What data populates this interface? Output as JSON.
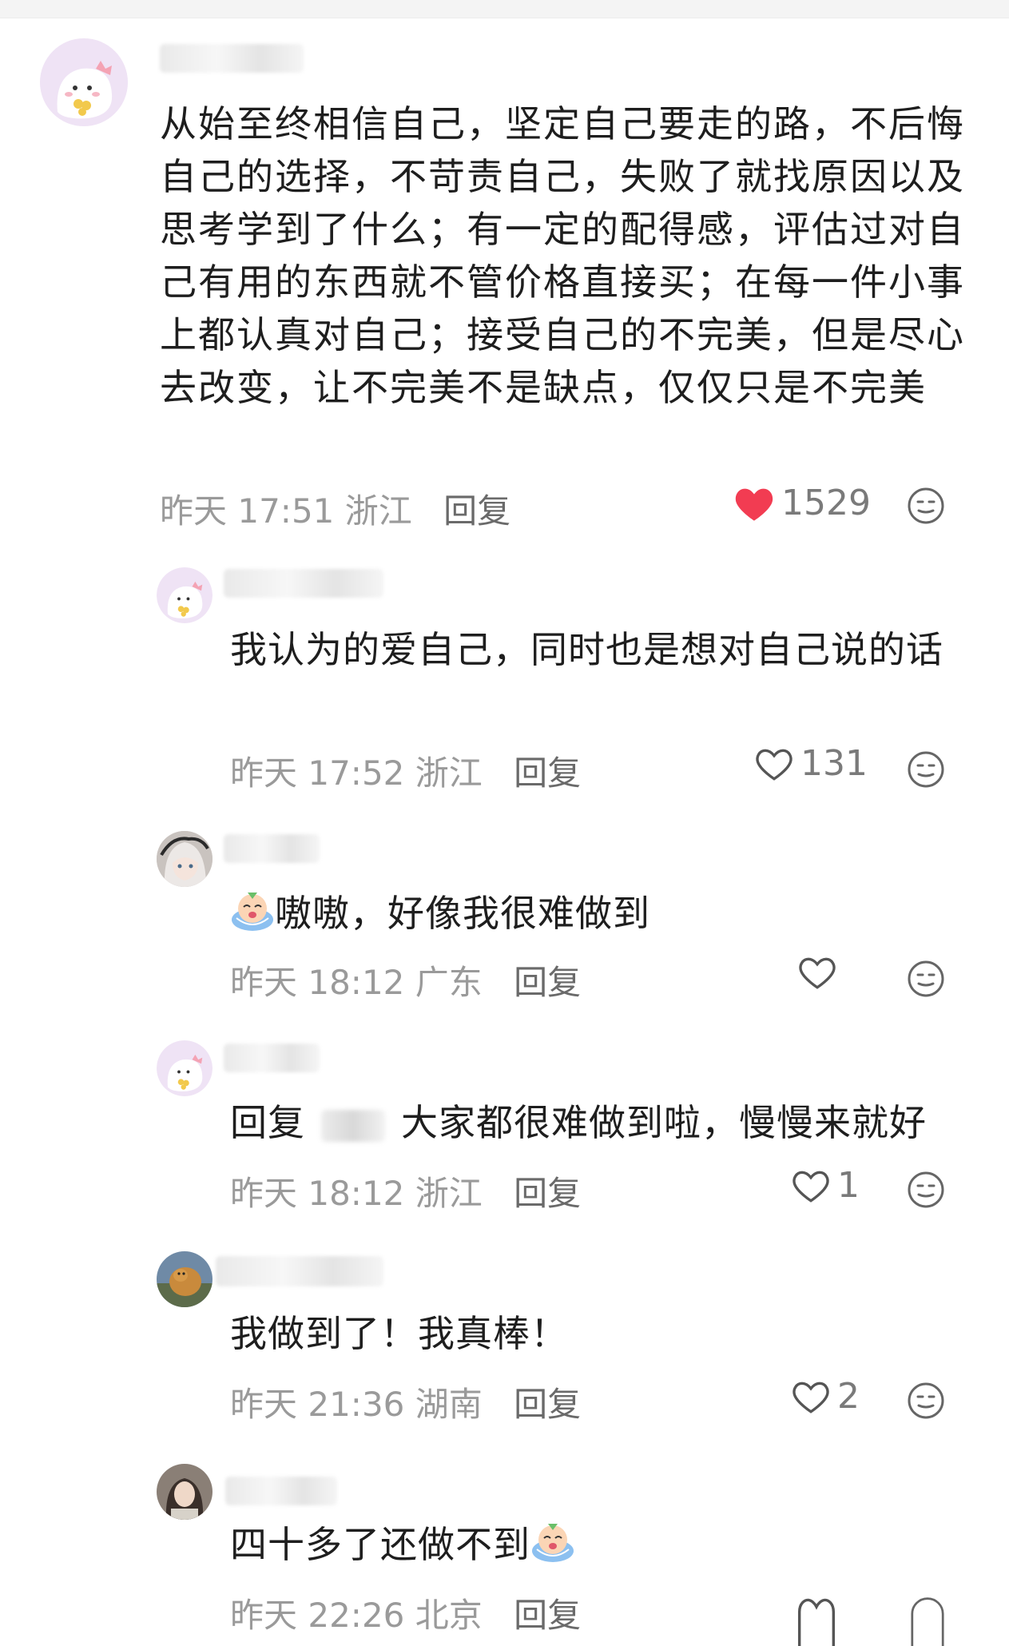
{
  "comments": [
    {
      "text": "从始至终相信自己，坚定自己要走的路，不后悔自己的选择，不苛责自己，失败了就找原因以及思考学到了什么；有一定的配得感，评估过对自己有用的东西就不管价格直接买；在每一件小事上都认真对自己；接受自己的不完美，但是尽心去改变，让不完美不是缺点，仅仅只是不完美",
      "time": "昨天 17:51",
      "location": "浙江",
      "reply_label": "回复",
      "likes": "1529",
      "liked": true
    }
  ],
  "replies": [
    {
      "text": "我认为的爱自己，同时也是想对自己说的话",
      "time": "昨天 17:52",
      "location": "浙江",
      "reply_label": "回复",
      "likes": "131"
    },
    {
      "text": "嗷嗷，好像我很难做到",
      "time": "昨天 18:12",
      "location": "广东",
      "reply_label": "回复",
      "likes": ""
    },
    {
      "prefix": "回复",
      "text": "大家都很难做到啦，慢慢来就好",
      "time": "昨天 18:12",
      "location": "浙江",
      "reply_label": "回复",
      "likes": "1"
    },
    {
      "text": "我做到了！我真棒！",
      "time": "昨天 21:36",
      "location": "湖南",
      "reply_label": "回复",
      "likes": "2"
    },
    {
      "text": "四十多了还做不到",
      "time": "昨天 22:26",
      "location": "北京",
      "reply_label": "回复"
    }
  ],
  "colors": {
    "like_red": "#f23c52",
    "meta_gray": "#9a9a9a",
    "text": "#1e1e1e"
  }
}
